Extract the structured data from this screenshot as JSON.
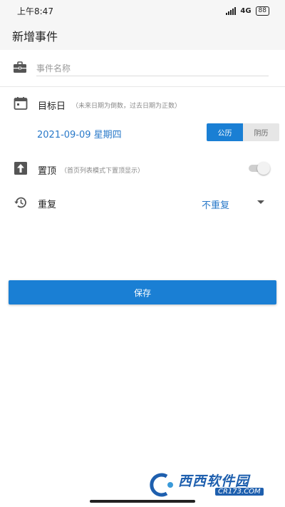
{
  "status_bar": {
    "time": "上午8:47",
    "network": "4G",
    "battery": "88"
  },
  "header": {
    "title": "新增事件"
  },
  "event_name": {
    "placeholder": "事件名称",
    "value": ""
  },
  "target_day": {
    "label": "目标日",
    "hint": "（未来日期为倒数，过去日期为正数）",
    "date": "2021-09-09 星期四",
    "calendar_options": [
      "公历",
      "阴历"
    ],
    "selected_calendar": "公历"
  },
  "pin": {
    "label": "置顶",
    "hint": "（首页列表模式下置顶显示）",
    "enabled": false
  },
  "repeat": {
    "label": "重复",
    "value": "不重复"
  },
  "save": {
    "label": "保存"
  },
  "watermark": {
    "title": "西西软件园",
    "domain": "CR173.COM"
  },
  "colors": {
    "accent": "#1a7fd4",
    "link": "#2979c9"
  }
}
